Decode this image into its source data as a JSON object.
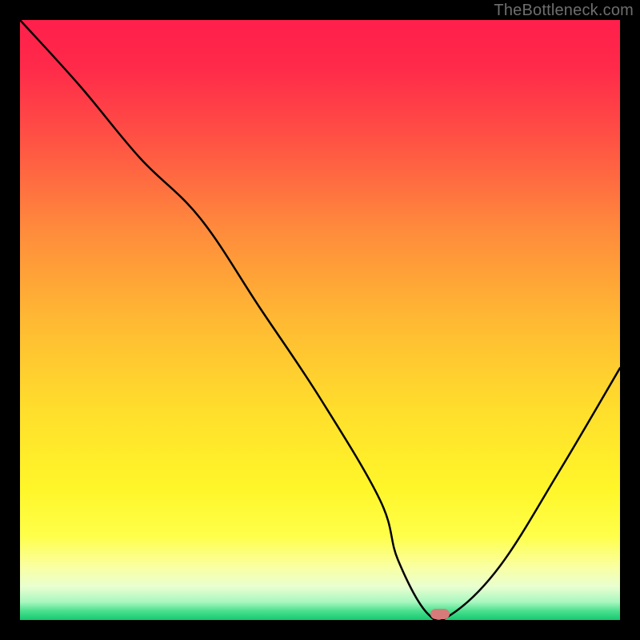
{
  "watermark": "TheBottleneck.com",
  "chart_data": {
    "type": "line",
    "title": "",
    "xlabel": "",
    "ylabel": "",
    "xlim": [
      0,
      100
    ],
    "ylim": [
      0,
      100
    ],
    "series": [
      {
        "name": "curve",
        "x": [
          0,
          10,
          20,
          30,
          40,
          50,
          60,
          63,
          68,
          72,
          80,
          90,
          100
        ],
        "y": [
          100,
          89,
          77,
          67,
          52,
          37,
          20,
          10,
          1,
          1,
          9,
          25,
          42
        ]
      }
    ],
    "marker": {
      "x": 70,
      "y": 1,
      "color": "#d77a7a"
    },
    "grid": false,
    "gradient_stops": [
      {
        "offset": 0.0,
        "color": "#ff1f4b"
      },
      {
        "offset": 0.08,
        "color": "#ff2a4a"
      },
      {
        "offset": 0.2,
        "color": "#ff5244"
      },
      {
        "offset": 0.35,
        "color": "#ff8b3c"
      },
      {
        "offset": 0.5,
        "color": "#ffb933"
      },
      {
        "offset": 0.65,
        "color": "#ffde2c"
      },
      {
        "offset": 0.78,
        "color": "#fff629"
      },
      {
        "offset": 0.86,
        "color": "#ffff4a"
      },
      {
        "offset": 0.91,
        "color": "#faffa0"
      },
      {
        "offset": 0.945,
        "color": "#e8ffd0"
      },
      {
        "offset": 0.97,
        "color": "#a8f7c0"
      },
      {
        "offset": 0.985,
        "color": "#4be08e"
      },
      {
        "offset": 1.0,
        "color": "#16c971"
      }
    ],
    "curve_color": "#000000",
    "curve_width": 2.5
  }
}
